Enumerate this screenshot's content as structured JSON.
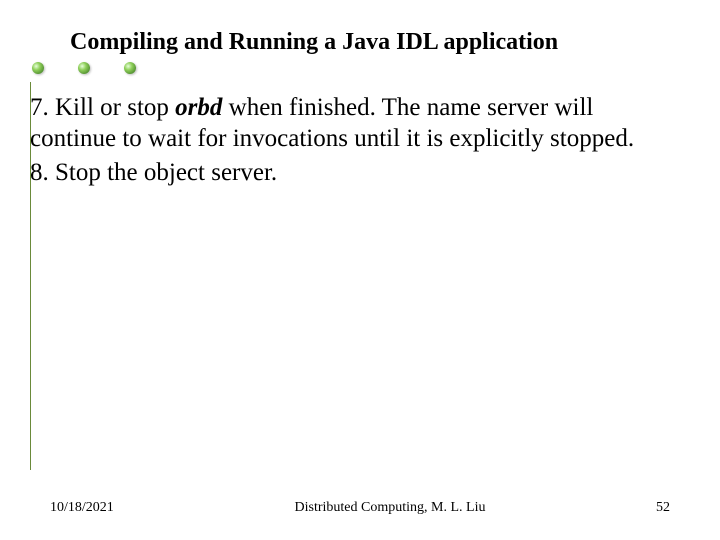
{
  "title": "Compiling and Running a Java IDL application",
  "bullets": {
    "count": 3
  },
  "body": {
    "items": [
      {
        "num": "7.",
        "pre": " Kill or stop ",
        "em": "orbd",
        "post": " when finished. The name server will continue to wait for invocations until it is explicitly stopped."
      },
      {
        "num": "8.",
        "pre": " Stop the object server.",
        "em": "",
        "post": ""
      }
    ]
  },
  "footer": {
    "date": "10/18/2021",
    "center": "Distributed Computing, M. L. Liu",
    "page": "52"
  }
}
